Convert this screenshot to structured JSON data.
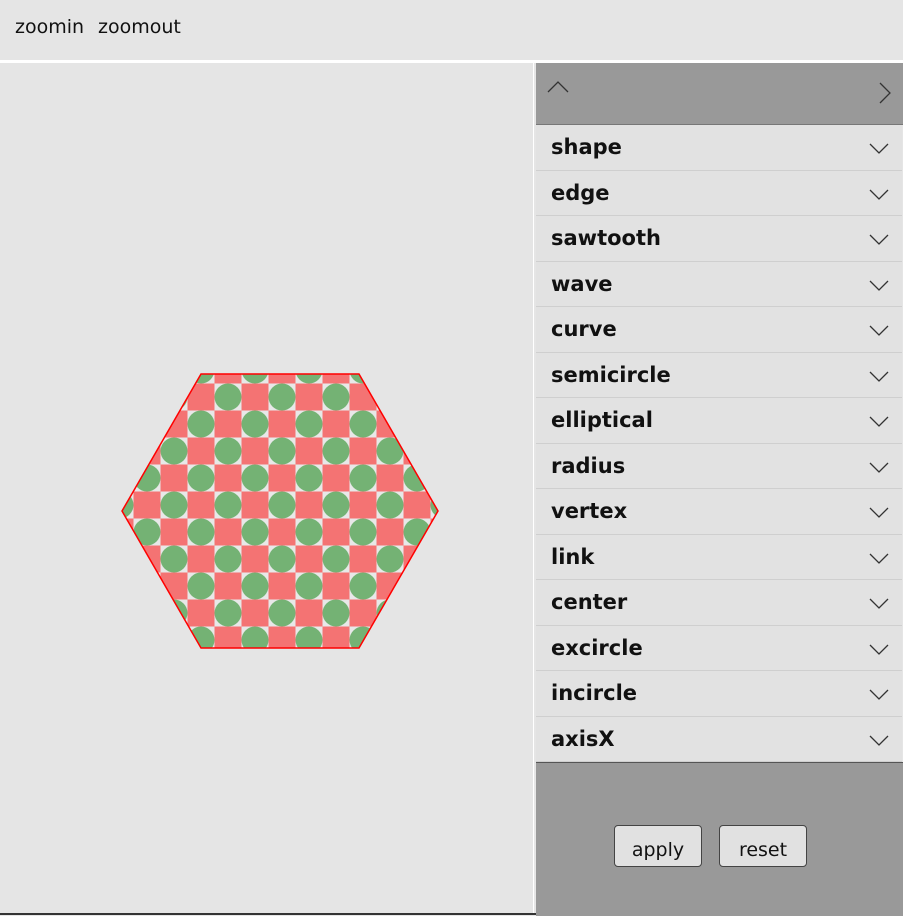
{
  "toolbar": {
    "zoomin_label": "zoomin",
    "zoomout_label": "zoomout"
  },
  "panel": {
    "items": [
      {
        "label": "shape"
      },
      {
        "label": "edge"
      },
      {
        "label": "sawtooth"
      },
      {
        "label": "wave"
      },
      {
        "label": "curve"
      },
      {
        "label": "semicircle"
      },
      {
        "label": "elliptical"
      },
      {
        "label": "radius"
      },
      {
        "label": "vertex"
      },
      {
        "label": "link"
      },
      {
        "label": "center"
      },
      {
        "label": "excircle"
      },
      {
        "label": "incircle"
      },
      {
        "label": "axisX"
      }
    ],
    "apply_label": "apply",
    "reset_label": "reset"
  },
  "colors": {
    "outline": "#ff0000",
    "square": "#f47373",
    "circle": "#74b274"
  },
  "icons": {
    "collapse": "chevron-up-icon",
    "next": "chevron-right-icon",
    "expand": "chevron-down-icon"
  }
}
